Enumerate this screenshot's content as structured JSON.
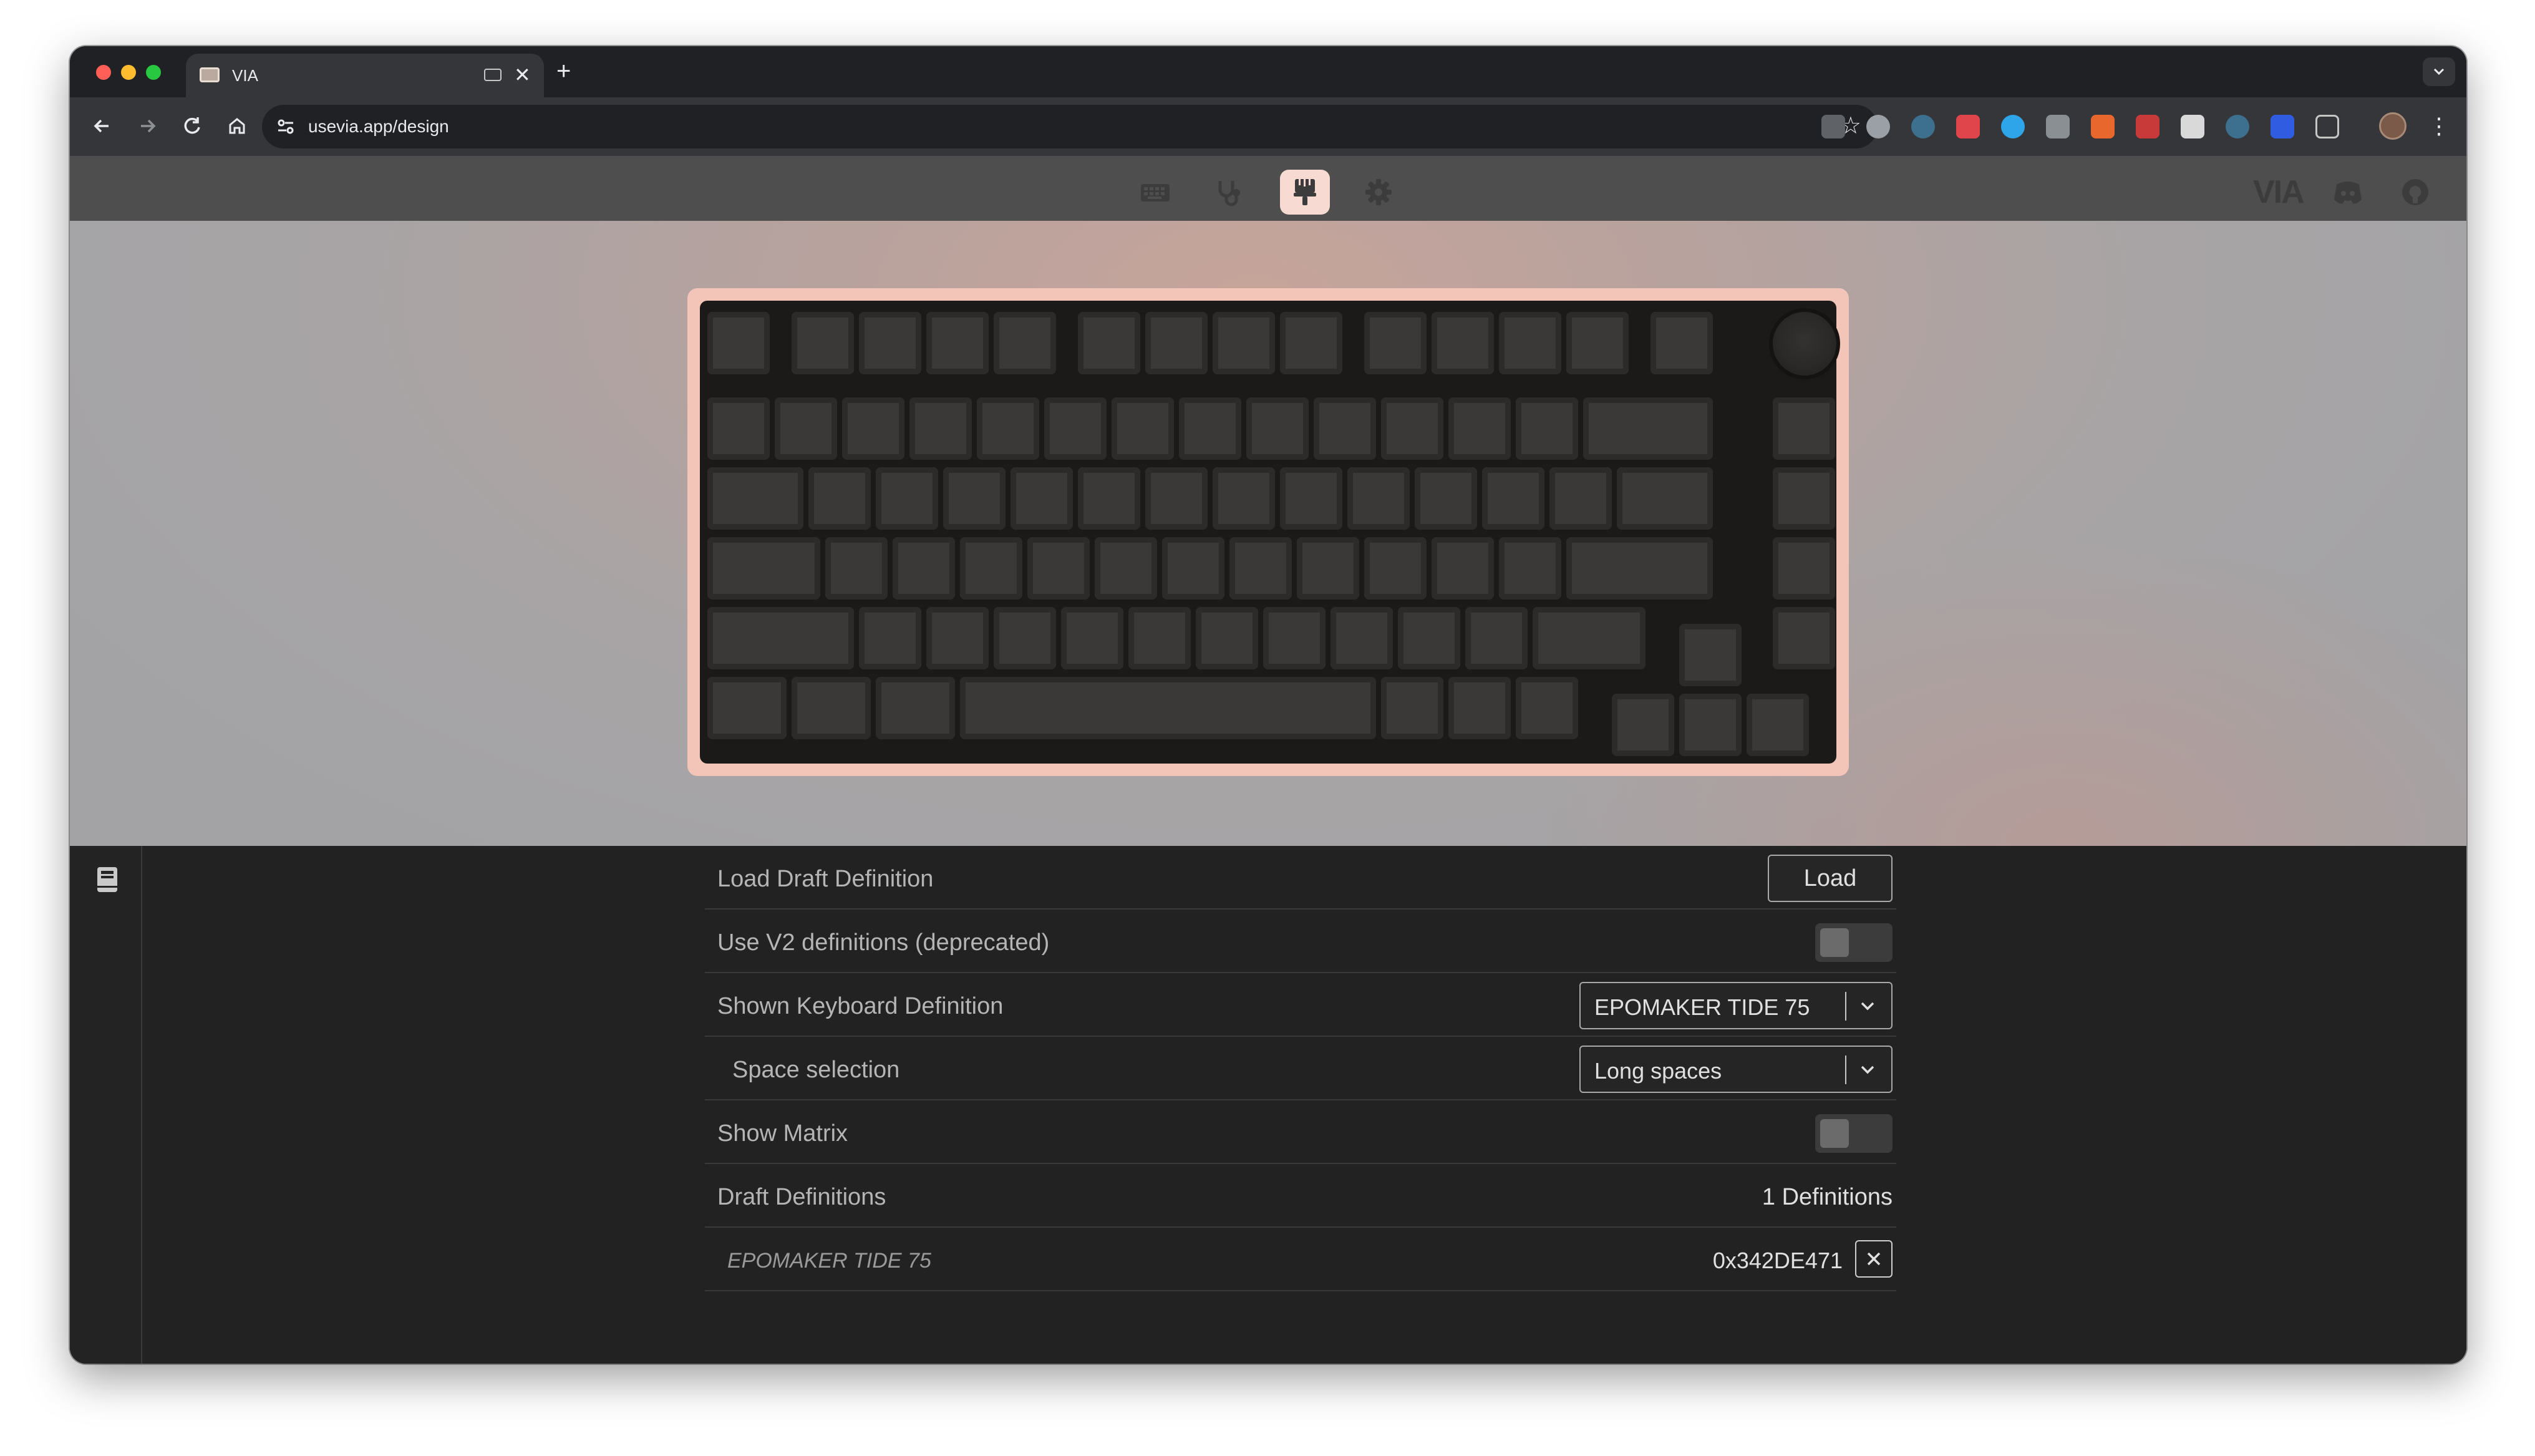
{
  "browser": {
    "tab_title": "VIA",
    "url": "usevia.app/design"
  },
  "app": {
    "brand": "VIA",
    "nav_icons": [
      "keyboard-icon",
      "stethoscope-icon",
      "paintbrush-icon",
      "gear-icon"
    ],
    "active_nav": "paintbrush-icon"
  },
  "colors": {
    "case": "#f3c4b8",
    "keycap": "#3b3938",
    "active_nav": "#f7dbd2",
    "pane_bg": "#222222"
  },
  "settings": {
    "load_draft": {
      "label": "Load Draft Definition",
      "button": "Load"
    },
    "use_v2": {
      "label": "Use V2 definitions (deprecated)",
      "enabled": false
    },
    "shown_definition": {
      "label": "Shown Keyboard Definition",
      "value": "EPOMAKER TIDE 75"
    },
    "space_selection": {
      "label": "Space selection",
      "value": "Long spaces"
    },
    "show_matrix": {
      "label": "Show Matrix",
      "enabled": false
    },
    "draft_definitions": {
      "label": "Draft Definitions",
      "count": "1 Definitions"
    },
    "draft_items": [
      {
        "name": "EPOMAKER TIDE 75",
        "id": "0x342DE471"
      }
    ]
  }
}
